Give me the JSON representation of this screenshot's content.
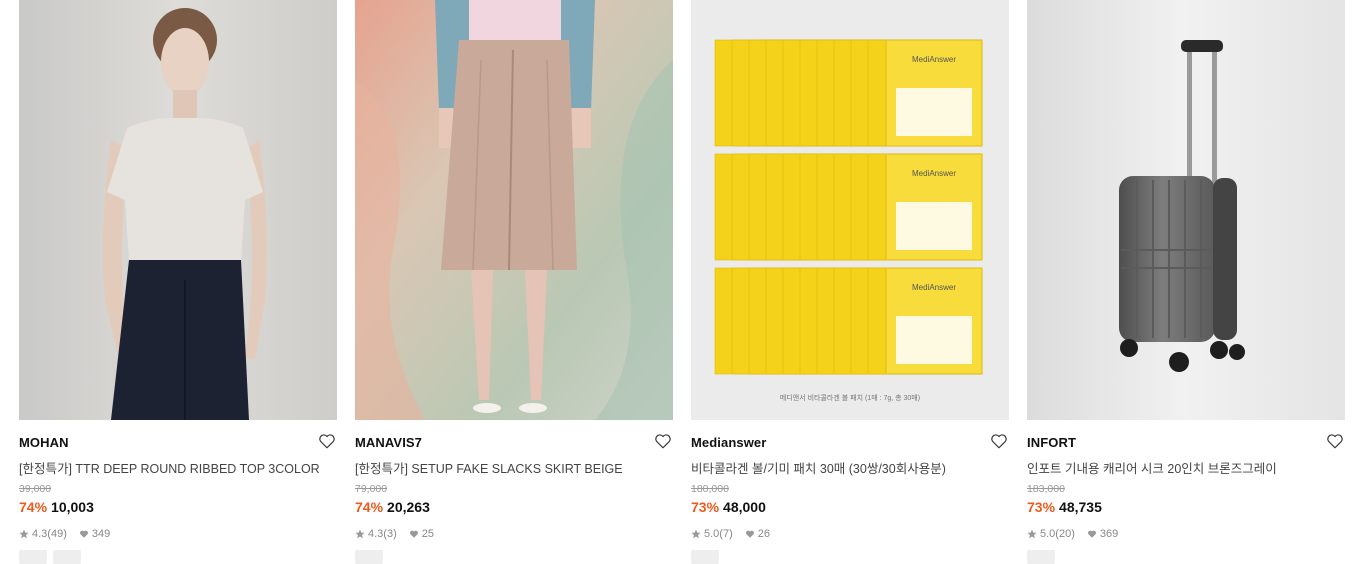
{
  "products": [
    {
      "brand": "MOHAN",
      "name": "[한정특가] TTR DEEP ROUND RIBBED TOP 3COLOR",
      "original_price": "39,000",
      "discount": "74%",
      "price": "10,003",
      "rating": "4.3",
      "reviews": "(49)",
      "likes": "349",
      "image_icon": "woman-tshirt-photo"
    },
    {
      "brand": "MANAVIS7",
      "name": "[한정특가] SETUP FAKE SLACKS SKIRT BEIGE",
      "original_price": "79,000",
      "discount": "74%",
      "price": "20,263",
      "rating": "4.3",
      "reviews": "(3)",
      "likes": "25",
      "image_icon": "skirt-model-photo"
    },
    {
      "brand": "Medianswer",
      "name": "비타콜라겐 볼/기미 패치 30매 (30쌍/30회사용분)",
      "original_price": "180,000",
      "discount": "73%",
      "price": "48,000",
      "rating": "5.0",
      "reviews": "(7)",
      "likes": "26",
      "image_icon": "patch-packs-photo",
      "image_pack_label": "MediAnswer",
      "image_caption": "메디앤서 비타콜라겐 볼 패치 (1매 : 7g, 총 30매)"
    },
    {
      "brand": "INFORT",
      "name": "인포트 기내용 캐리어 시크 20인치 브론즈그레이",
      "original_price": "183,000",
      "discount": "73%",
      "price": "48,735",
      "rating": "5.0",
      "reviews": "(20)",
      "likes": "369",
      "image_icon": "suitcase-photo"
    }
  ],
  "colors": {
    "discount": "#f2591d",
    "price": "#111111",
    "muted": "#999999"
  }
}
